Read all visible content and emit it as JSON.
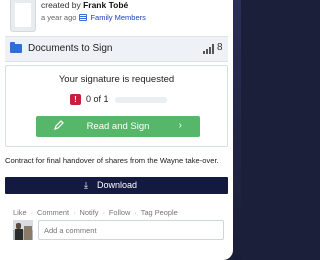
{
  "header": {
    "created_prefix": "created by",
    "author": "Frank Tobé",
    "time": "a year ago",
    "group": "Family Members"
  },
  "folder": {
    "title": "Documents to Sign",
    "count": "8"
  },
  "signature": {
    "title": "Your signature is requested",
    "alert_glyph": "!",
    "count_text": "0 of 1",
    "progress": 0.0,
    "button_label": "Read and Sign",
    "button_chevron": "›",
    "accent": "#56b76a",
    "alert_color": "#c8203a"
  },
  "description": "Contract for final handover of shares from the Wayne take-over.",
  "download": {
    "label": "Download",
    "icon_glyph": "⤓",
    "bg": "#141a3f"
  },
  "actions": [
    "Like",
    "Comment",
    "Notify",
    "Follow",
    "Tag People"
  ],
  "actions_sep": "·",
  "comment": {
    "placeholder": "Add a comment"
  }
}
